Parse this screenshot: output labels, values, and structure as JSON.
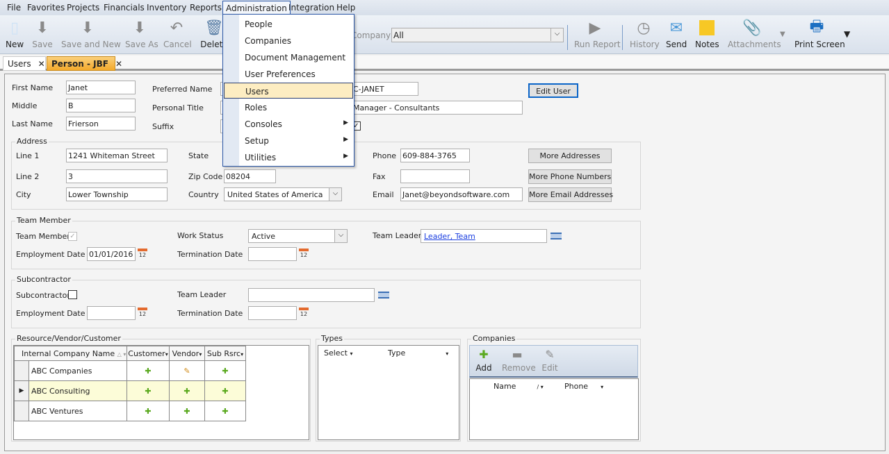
{
  "menu": [
    "File",
    "Favorites",
    "Projects",
    "Financials",
    "Inventory",
    "Reports",
    "Administration",
    "Integration",
    "Help"
  ],
  "toolbar": {
    "new": "New",
    "save": "Save",
    "save_and_new": "Save and New",
    "save_as": "Save As",
    "cancel": "Cancel",
    "delete": "Delete",
    "company_label": "Company",
    "company_value": "All",
    "run_report": "Run Report",
    "history": "History",
    "send": "Send",
    "notes": "Notes",
    "attachments": "Attachments",
    "print_screen": "Print Screen"
  },
  "tabs": [
    {
      "label": "Users"
    },
    {
      "label": "Person - JBF",
      "active": true
    }
  ],
  "admin_menu": [
    {
      "label": "People"
    },
    {
      "label": "Companies"
    },
    {
      "label": "Document Management"
    },
    {
      "label": "User Preferences"
    },
    {
      "label": "Users",
      "highlighted": true
    },
    {
      "label": "Roles"
    },
    {
      "label": "Consoles",
      "submenu": true
    },
    {
      "label": "Setup",
      "submenu": true
    },
    {
      "label": "Utilities",
      "submenu": true
    }
  ],
  "person": {
    "first_name_label": "First Name",
    "first_name": "Janet",
    "middle_label": "Middle",
    "middle": "B",
    "last_name_label": "Last Name",
    "last_name": "Frierson",
    "preferred_name_label": "Preferred Name",
    "preferred_name_visible": "C-JANET",
    "personal_title_label": "Personal Title",
    "personal_title_visible": "Manager - Consultants",
    "suffix_label": "Suffix",
    "edit_user": "Edit User"
  },
  "address": {
    "title": "Address",
    "line1_label": "Line 1",
    "line1": "1241 Whiteman Street",
    "line2_label": "Line 2",
    "line2": "3",
    "city_label": "City",
    "city": "Lower Township",
    "state_label": "State",
    "zip_label": "Zip Code",
    "zip": "08204",
    "country_label": "Country",
    "country": "United States of America",
    "phone_label": "Phone",
    "phone": "609-884-3765",
    "fax_label": "Fax",
    "fax": "",
    "email_label": "Email",
    "email": "Janet@beyondsoftware.com",
    "more_addresses": "More Addresses",
    "more_phone": "More Phone Numbers",
    "more_email": "More Email Addresses"
  },
  "team_member": {
    "title": "Team Member",
    "team_member_label": "Team Member",
    "team_member_checked": true,
    "work_status_label": "Work Status",
    "work_status": "Active",
    "team_leader_label": "Team Leader",
    "team_leader": "Leader, Team",
    "employment_date_label": "Employment Date",
    "employment_date": "01/01/2016",
    "termination_date_label": "Termination Date",
    "termination_date": "",
    "calendar_icon_text": "12"
  },
  "subcontractor": {
    "title": "Subcontractor",
    "subcontractor_label": "Subcontractor",
    "subcontractor_checked": false,
    "team_leader_label": "Team Leader",
    "employment_date_label": "Employment Date",
    "termination_date_label": "Termination Date"
  },
  "rvc": {
    "title": "Resource/Vendor/Customer",
    "columns": [
      "Internal Company Name",
      "Customer",
      "Vendor",
      "Sub Rsrc"
    ],
    "rows": [
      {
        "name": "ABC Companies",
        "customer": "add",
        "vendor": "edit",
        "sub": "add"
      },
      {
        "name": "ABC Consulting",
        "customer": "add",
        "vendor": "add",
        "sub": "add",
        "selected": true
      },
      {
        "name": "ABC Ventures",
        "customer": "add",
        "vendor": "add",
        "sub": "add"
      }
    ]
  },
  "types": {
    "title": "Types",
    "columns": [
      "Select",
      "Type"
    ]
  },
  "companies": {
    "title": "Companies",
    "add": "Add",
    "remove": "Remove",
    "edit": "Edit",
    "columns": [
      "Name",
      "Phone"
    ]
  }
}
